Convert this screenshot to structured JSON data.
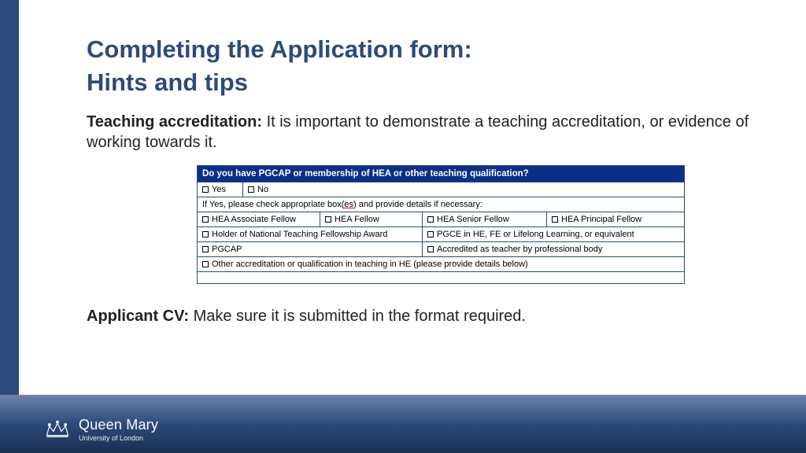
{
  "heading_line1": "Completing the Application form:",
  "heading_line2": "Hints and tips",
  "teaching": {
    "label": "Teaching accreditation:",
    "text": " It is important to demonstrate a teaching accreditation, or evidence of working towards it."
  },
  "form": {
    "header": "Do you have PGCAP or membership of HEA or other teaching qualification?",
    "yes": "Yes",
    "no": "No",
    "ifyes_pre": "If Yes, please check appropriate box(",
    "ifyes_ul": "es",
    "ifyes_post": ") and provide details if necessary:",
    "opts": {
      "assoc": "HEA Associate Fellow",
      "fellow": "HEA Fellow",
      "senior": "HEA Senior Fellow",
      "principal": "HEA Principal Fellow",
      "ntfa": "Holder of National Teaching Fellowship Award",
      "pgce": "PGCE in HE, FE or Lifelong Learning, or equivalent",
      "pgcap": "PGCAP",
      "accred": "Accredited as teacher by professional body",
      "other": "Other accreditation or qualification in teaching in HE (please provide details below)"
    }
  },
  "applicant": {
    "label": "Applicant CV:",
    "text": " Make sure it is submitted in the format required."
  },
  "brand": {
    "name": "Queen Mary",
    "sub": "University of London"
  }
}
